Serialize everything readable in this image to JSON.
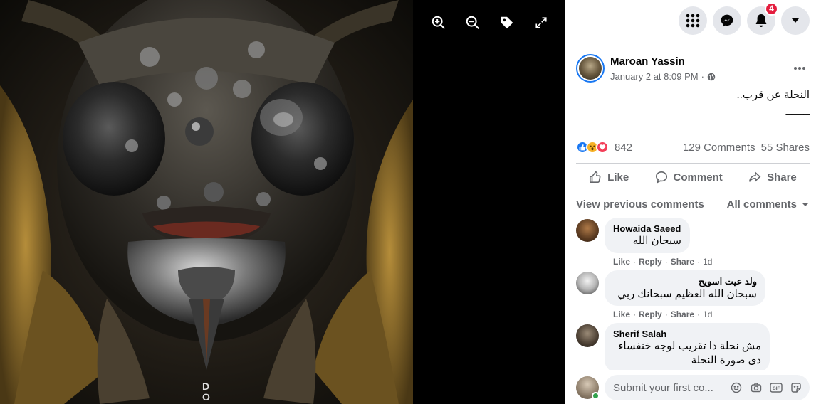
{
  "viewer": {
    "watermark": "D\nO",
    "tools": [
      "zoom-in-icon",
      "zoom-out-icon",
      "tag-icon",
      "fullscreen-icon"
    ]
  },
  "topbar": {
    "notifications_count": "4"
  },
  "post": {
    "author": "Maroan Yassin",
    "date": "January 2 at 8:09 PM",
    "separator": "·",
    "caption_line1": "النحلة عن قرب..",
    "caption_line2": "____",
    "reactions_count": "842",
    "comments_count": "129 Comments",
    "shares_count": "55 Shares"
  },
  "actions": {
    "like": "Like",
    "comment": "Comment",
    "share": "Share"
  },
  "comments_nav": {
    "previous": "View previous comments",
    "filter": "All comments"
  },
  "comments": [
    {
      "name": "Howaida Saeed",
      "text": "سبحان الله",
      "like": "Like",
      "reply": "Reply",
      "share": "Share",
      "time": "1d"
    },
    {
      "name": "ولد عيت اسويح",
      "text": "سبحان الله العظيم سبحانك ربي",
      "like": "Like",
      "reply": "Reply",
      "share": "Share",
      "time": "1d"
    },
    {
      "name": "Sherif Salah",
      "text_line1": "مش نحلة دا تقريب لوجه خنفساء",
      "text_line2": "دى صورة النحلة"
    }
  ],
  "composer": {
    "placeholder": "Submit your first co..."
  },
  "colors": {
    "accent": "#1877f2",
    "badge": "#e41e3f",
    "text_secondary": "#65676b"
  }
}
